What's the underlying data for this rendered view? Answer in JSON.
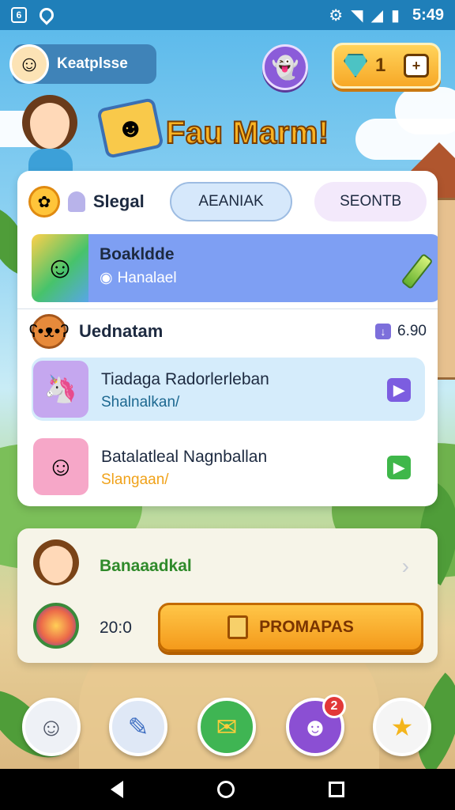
{
  "status_bar": {
    "left_badge": "6",
    "time": "5:49"
  },
  "header": {
    "profile_name": "Keatplsse",
    "gem_count": "1"
  },
  "hero": {
    "title": "Fau Marm!"
  },
  "main_card": {
    "title": "Slegal",
    "tabs": [
      {
        "label": "AEANIAK",
        "active": true
      },
      {
        "label": "SEONTB",
        "active": false
      }
    ],
    "featured": {
      "title": "Boakldde",
      "subtitle": "Hanalael"
    },
    "section": {
      "title": "Uednatam",
      "meta": "6.90"
    },
    "items": [
      {
        "title": "Tiadaga Radorlerleban",
        "subtitle": "Shalnalkan/"
      },
      {
        "title": "Batalatleal Nagnballan",
        "subtitle": "Slangaan/"
      }
    ]
  },
  "reward_card": {
    "title": "Banaaadkal",
    "amount": "20:0",
    "button_label": "PROMAPAS"
  },
  "bottom_nav": {
    "messages_badge": "2"
  },
  "colors": {
    "status_bar": "#1f7fb9",
    "featured_row": "#7e9ff3",
    "promo_button": "#f49a1b",
    "reward_title": "#2f8a2a"
  }
}
